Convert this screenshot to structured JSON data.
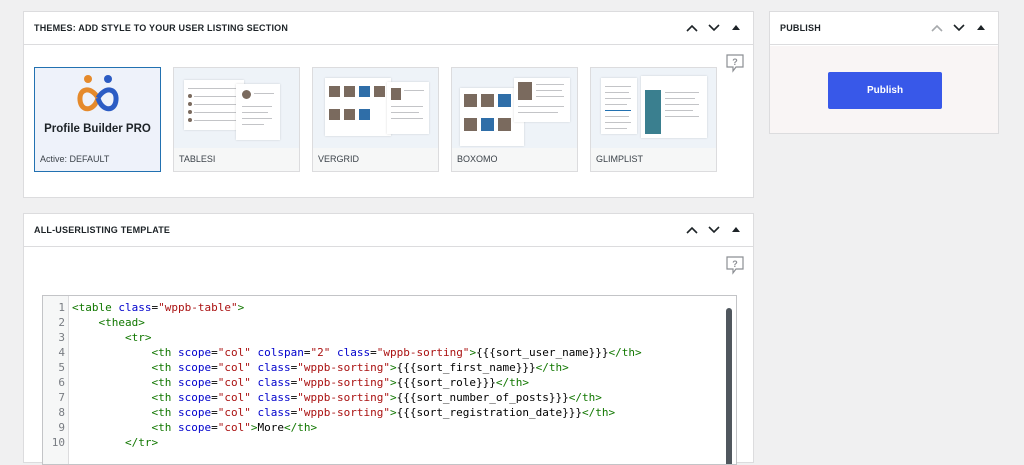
{
  "themes_panel": {
    "title": "Themes: Add style to your User Listing section",
    "themes": [
      {
        "name": "DEFAULT",
        "active_prefix": "Active:",
        "logo_text": "Profile Builder PRO"
      },
      {
        "name": "TABLESI"
      },
      {
        "name": "VERGRID"
      },
      {
        "name": "BOXOMO"
      },
      {
        "name": "GLIMPLIST"
      }
    ]
  },
  "template_panel": {
    "title": "All-Userlisting Template",
    "code_lines": [
      {
        "n": "1",
        "tokens": [
          [
            "tg",
            "<table "
          ],
          [
            "at",
            "class"
          ],
          [
            "tx",
            "="
          ],
          [
            "st",
            "\"wppb-table\""
          ],
          [
            "tg",
            ">"
          ]
        ]
      },
      {
        "n": "2",
        "tokens": [
          [
            "tx",
            "    "
          ],
          [
            "tg",
            "<thead>"
          ]
        ]
      },
      {
        "n": "3",
        "tokens": [
          [
            "tx",
            "        "
          ],
          [
            "tg",
            "<tr>"
          ]
        ]
      },
      {
        "n": "4",
        "tokens": [
          [
            "tx",
            "            "
          ],
          [
            "tg",
            "<th "
          ],
          [
            "at",
            "scope"
          ],
          [
            "tx",
            "="
          ],
          [
            "st",
            "\"col\""
          ],
          [
            "tx",
            " "
          ],
          [
            "at",
            "colspan"
          ],
          [
            "tx",
            "="
          ],
          [
            "st",
            "\"2\""
          ],
          [
            "tx",
            " "
          ],
          [
            "at",
            "class"
          ],
          [
            "tx",
            "="
          ],
          [
            "st",
            "\"wppb-sorting\""
          ],
          [
            "tg",
            ">"
          ],
          [
            "tx",
            "{{{sort_user_name}}}"
          ],
          [
            "tg",
            "</th>"
          ]
        ]
      },
      {
        "n": "5",
        "tokens": [
          [
            "tx",
            "            "
          ],
          [
            "tg",
            "<th "
          ],
          [
            "at",
            "scope"
          ],
          [
            "tx",
            "="
          ],
          [
            "st",
            "\"col\""
          ],
          [
            "tx",
            " "
          ],
          [
            "at",
            "class"
          ],
          [
            "tx",
            "="
          ],
          [
            "st",
            "\"wppb-sorting\""
          ],
          [
            "tg",
            ">"
          ],
          [
            "tx",
            "{{{sort_first_name}}}"
          ],
          [
            "tg",
            "</th>"
          ]
        ]
      },
      {
        "n": "6",
        "tokens": [
          [
            "tx",
            "            "
          ],
          [
            "tg",
            "<th "
          ],
          [
            "at",
            "scope"
          ],
          [
            "tx",
            "="
          ],
          [
            "st",
            "\"col\""
          ],
          [
            "tx",
            " "
          ],
          [
            "at",
            "class"
          ],
          [
            "tx",
            "="
          ],
          [
            "st",
            "\"wppb-sorting\""
          ],
          [
            "tg",
            ">"
          ],
          [
            "tx",
            "{{{sort_role}}}"
          ],
          [
            "tg",
            "</th>"
          ]
        ]
      },
      {
        "n": "7",
        "tokens": [
          [
            "tx",
            "            "
          ],
          [
            "tg",
            "<th "
          ],
          [
            "at",
            "scope"
          ],
          [
            "tx",
            "="
          ],
          [
            "st",
            "\"col\""
          ],
          [
            "tx",
            " "
          ],
          [
            "at",
            "class"
          ],
          [
            "tx",
            "="
          ],
          [
            "st",
            "\"wppb-sorting\""
          ],
          [
            "tg",
            ">"
          ],
          [
            "tx",
            "{{{sort_number_of_posts}}}"
          ],
          [
            "tg",
            "</th>"
          ]
        ]
      },
      {
        "n": "8",
        "tokens": [
          [
            "tx",
            "            "
          ],
          [
            "tg",
            "<th "
          ],
          [
            "at",
            "scope"
          ],
          [
            "tx",
            "="
          ],
          [
            "st",
            "\"col\""
          ],
          [
            "tx",
            " "
          ],
          [
            "at",
            "class"
          ],
          [
            "tx",
            "="
          ],
          [
            "st",
            "\"wppb-sorting\""
          ],
          [
            "tg",
            ">"
          ],
          [
            "tx",
            "{{{sort_registration_date}}}"
          ],
          [
            "tg",
            "</th>"
          ]
        ]
      },
      {
        "n": "9",
        "tokens": [
          [
            "tx",
            "            "
          ],
          [
            "tg",
            "<th "
          ],
          [
            "at",
            "scope"
          ],
          [
            "tx",
            "="
          ],
          [
            "st",
            "\"col\""
          ],
          [
            "tg",
            ">"
          ],
          [
            "tx",
            "More"
          ],
          [
            "tg",
            "</th>"
          ]
        ]
      },
      {
        "n": "10",
        "tokens": [
          [
            "tx",
            "        "
          ],
          [
            "tg",
            "</tr>"
          ]
        ]
      }
    ]
  },
  "publish_panel": {
    "title": "Publish",
    "button_label": "Publish"
  },
  "colors": {
    "accent": "#3858e9",
    "active_border": "#2271b1"
  }
}
